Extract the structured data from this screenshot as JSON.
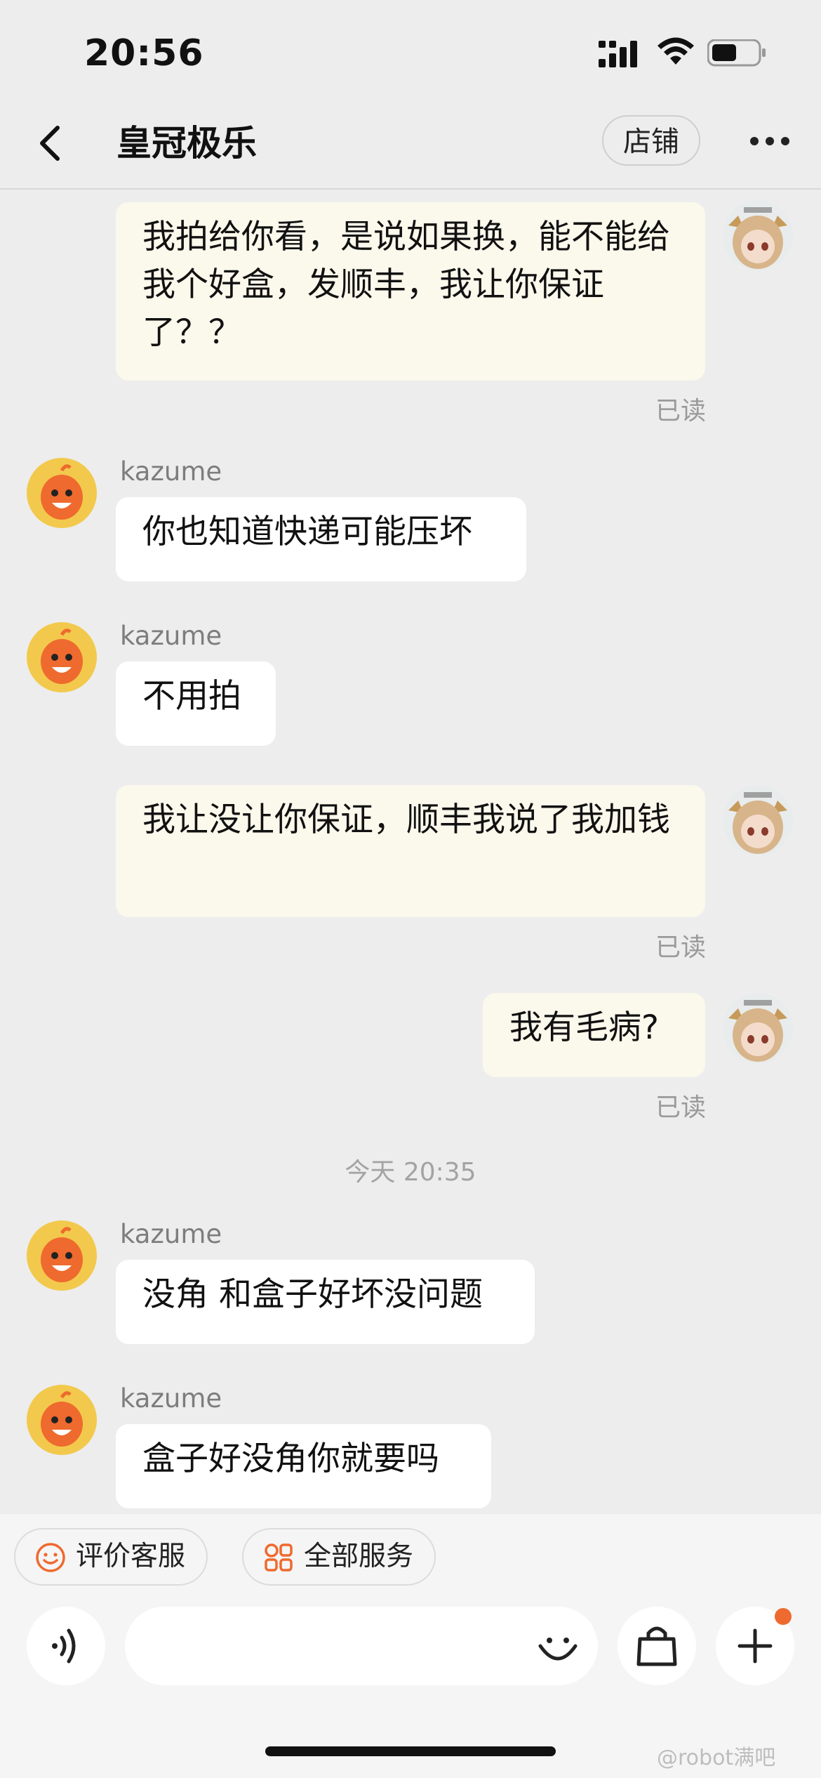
{
  "status_bar": {
    "time": "20:56"
  },
  "header": {
    "back_icon": "chevron-left-icon",
    "title": "皇冠极乐",
    "shop_label": "店铺",
    "more_icon": "ellipsis-icon"
  },
  "messages": [
    {
      "side": "mine",
      "text": "我拍给你看，是说如果换，能不能给我个好盒，发顺丰，我让你保证了？？",
      "read": "已读"
    },
    {
      "side": "theirs",
      "sender": "kazume",
      "text": "你也知道快递可能压坏"
    },
    {
      "side": "theirs",
      "sender": "kazume",
      "text": "不用拍"
    },
    {
      "side": "mine",
      "text": "我让没让你保证，顺丰我说了我加钱",
      "read": "已读"
    },
    {
      "side": "mine",
      "text": "我有毛病?",
      "read": "已读"
    },
    {
      "side": "theirs",
      "sender": "kazume",
      "text": "没角 和盒子好坏没问题"
    },
    {
      "side": "theirs",
      "sender": "kazume",
      "text": "盒子好没角你就要吗"
    }
  ],
  "time_divider": "今天 20:35",
  "quick_actions": [
    {
      "label": "评价客服",
      "icon": "smile-face-icon"
    },
    {
      "label": "全部服务",
      "icon": "services-grid-icon"
    }
  ],
  "input_bar": {
    "voice_icon": "voice-icon",
    "placeholder": "",
    "emoji_icon": "emoji-icon",
    "shop_bag_icon": "shopping-bag-icon",
    "plus_icon": "plus-icon"
  },
  "watermark": "@robot满吧",
  "colors": {
    "background": "#ededed",
    "bubble_mine": "#fbf8ec",
    "bubble_theirs": "#ffffff",
    "accent_orange": "#ef6a2e",
    "muted_text": "#9a9a9a"
  }
}
